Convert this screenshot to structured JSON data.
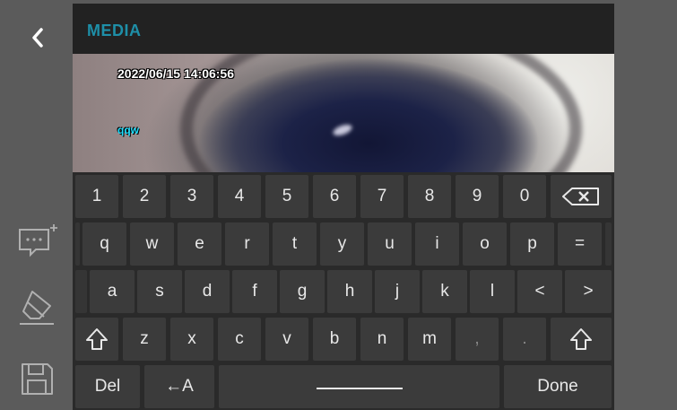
{
  "header": {
    "title": "MEDIA"
  },
  "preview": {
    "timestamp": "2022/06/15 14:06:56",
    "overlay_text": "qqw"
  },
  "icons": {
    "back": "chevron-left-icon",
    "add_text": "add-text-icon",
    "eraser": "eraser-icon",
    "save": "save-icon"
  },
  "keyboard": {
    "row1": [
      "1",
      "2",
      "3",
      "4",
      "5",
      "6",
      "7",
      "8",
      "9",
      "0"
    ],
    "backspace_icon": "backspace-icon",
    "row2": [
      "q",
      "w",
      "e",
      "r",
      "t",
      "y",
      "u",
      "i",
      "o",
      "p",
      "="
    ],
    "row3": [
      "a",
      "s",
      "d",
      "f",
      "g",
      "h",
      "j",
      "k",
      "l",
      "<",
      ">"
    ],
    "shift_icon": "shift-icon",
    "row4": [
      "z",
      "x",
      "c",
      "v",
      "b",
      "n",
      "m",
      ",",
      "."
    ],
    "del_label": "Del",
    "back_a_label": "←A",
    "done_label": "Done"
  },
  "colors": {
    "title": "#1e8fa8",
    "background": "#5a5a5a",
    "keyboard": "#2a2a2a",
    "key": "#3b3b3b"
  }
}
